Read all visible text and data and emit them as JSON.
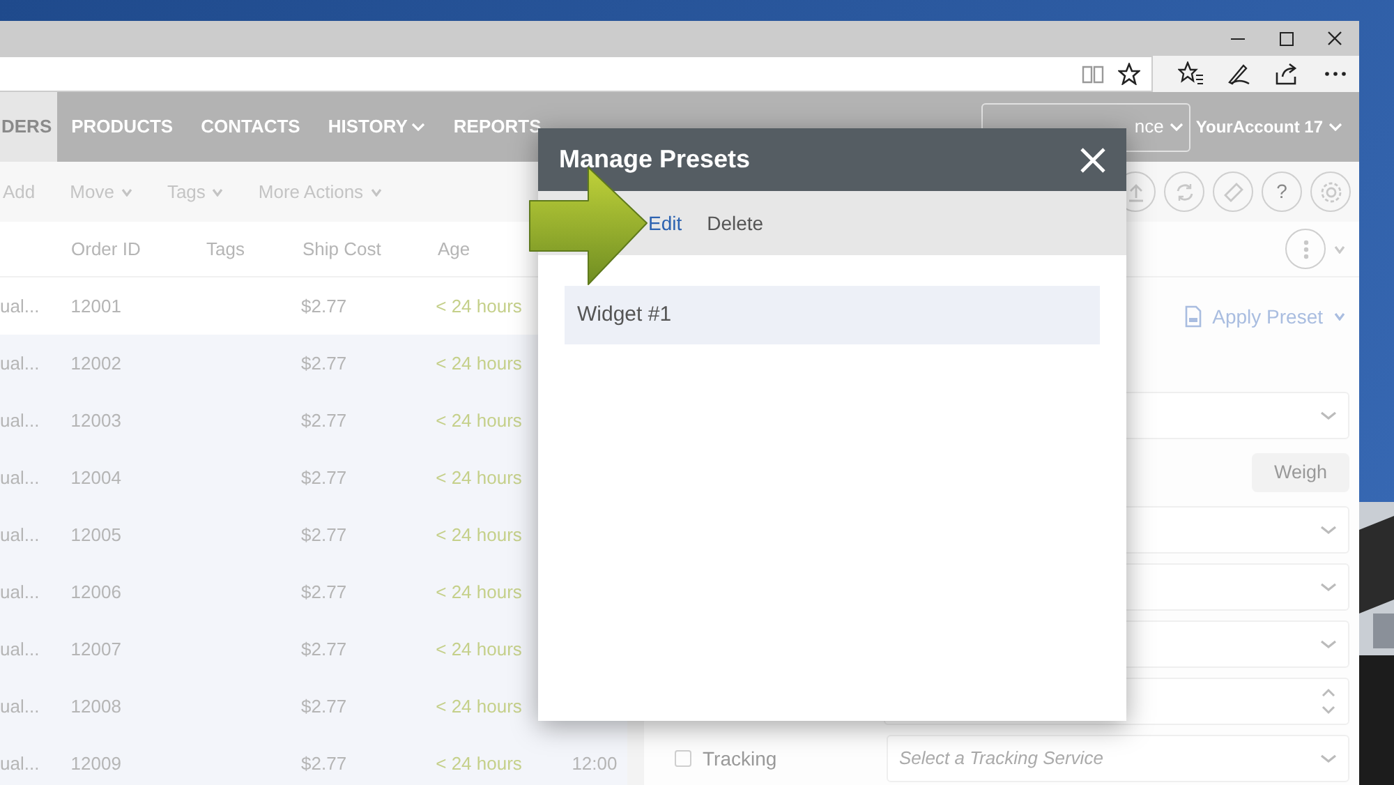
{
  "app_nav": {
    "tabs": [
      {
        "label": "DERS",
        "selected": true,
        "dropdown": false
      },
      {
        "label": "PRODUCTS",
        "selected": false,
        "dropdown": false
      },
      {
        "label": "CONTACTS",
        "selected": false,
        "dropdown": false
      },
      {
        "label": "HISTORY",
        "selected": false,
        "dropdown": true
      },
      {
        "label": "REPORTS",
        "selected": false,
        "dropdown": false
      }
    ],
    "location_selector": "nce",
    "account": "YourAccount 17"
  },
  "toolbar": {
    "actions": [
      {
        "label": "Add",
        "dropdown": false
      },
      {
        "label": "Move",
        "dropdown": true
      },
      {
        "label": "Tags",
        "dropdown": true
      },
      {
        "label": "More Actions",
        "dropdown": true
      }
    ],
    "help_glyph": "?"
  },
  "table": {
    "columns": {
      "order_id": "Order ID",
      "tags": "Tags",
      "ship_cost": "Ship Cost",
      "age": "Age"
    },
    "rows": [
      {
        "column_1": "ual...",
        "order_id": "12001",
        "ship_cost": "$2.77",
        "age": "< 24 hours",
        "selected": true
      },
      {
        "column_1": "ual...",
        "order_id": "12002",
        "ship_cost": "$2.77",
        "age": "< 24 hours",
        "selected": false
      },
      {
        "column_1": "ual...",
        "order_id": "12003",
        "ship_cost": "$2.77",
        "age": "< 24 hours",
        "selected": false
      },
      {
        "column_1": "ual...",
        "order_id": "12004",
        "ship_cost": "$2.77",
        "age": "< 24 hours",
        "selected": false
      },
      {
        "column_1": "ual...",
        "order_id": "12005",
        "ship_cost": "$2.77",
        "age": "< 24 hours",
        "selected": false
      },
      {
        "column_1": "ual...",
        "order_id": "12006",
        "ship_cost": "$2.77",
        "age": "< 24 hours",
        "selected": false
      },
      {
        "column_1": "ual...",
        "order_id": "12007",
        "ship_cost": "$2.77",
        "age": "< 24 hours",
        "selected": false
      },
      {
        "column_1": "ual...",
        "order_id": "12008",
        "ship_cost": "$2.77",
        "age": "< 24 hours",
        "selected": false
      },
      {
        "column_1": "ual...",
        "order_id": "12009",
        "ship_cost": "$2.77",
        "age": "< 24 hours",
        "column_6": "12:00",
        "selected": false
      }
    ]
  },
  "details": {
    "apply_preset": "Apply Preset",
    "fields": [
      {
        "kind": "select"
      },
      {
        "kind": "weigh",
        "label": "Weigh"
      },
      {
        "kind": "select"
      },
      {
        "kind": "select"
      },
      {
        "kind": "select"
      },
      {
        "kind": "spinner"
      },
      {
        "kind": "tracking",
        "label": "Tracking",
        "checked": false,
        "placeholder": "Select a Tracking Service"
      }
    ]
  },
  "modal": {
    "title": "Manage Presets",
    "actions": [
      {
        "label": "Edit",
        "active": true
      },
      {
        "label": "Delete",
        "active": false
      }
    ],
    "presets": [
      {
        "name": "Widget #1",
        "selected": true
      }
    ]
  }
}
